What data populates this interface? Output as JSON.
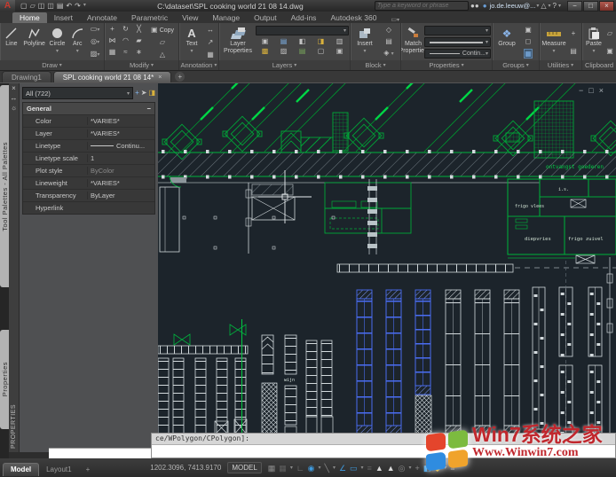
{
  "title_bar": {
    "document_path": "C:\\dataset\\SPL cooking world 21 08 14.dwg",
    "search_placeholder": "Type a keyword or phrase",
    "user_name": "jo.de.leeuw@..."
  },
  "ribbon": {
    "tabs": [
      "Home",
      "Insert",
      "Annotate",
      "Parametric",
      "View",
      "Manage",
      "Output",
      "Add-ins",
      "Autodesk 360"
    ],
    "panels": {
      "draw": {
        "label": "Draw",
        "line": "Line",
        "polyline": "Polyline",
        "circle": "Circle",
        "arc": "Arc"
      },
      "modify": {
        "label": "Modify",
        "copy": "Copy"
      },
      "annotation": {
        "label": "Annotation",
        "text": "Text"
      },
      "layers": {
        "label": "Layers",
        "layer_properties": "Layer Properties"
      },
      "block": {
        "label": "Block",
        "insert": "Insert"
      },
      "properties": {
        "label": "Properties",
        "match_properties": "Match Properties",
        "linetype_value": "Contin..."
      },
      "groups": {
        "label": "Groups",
        "group": "Group"
      },
      "utilities": {
        "label": "Utilities",
        "measure": "Measure"
      },
      "clipboard": {
        "label": "Clipboard",
        "paste": "Paste"
      }
    }
  },
  "document_tabs": {
    "drawing1": "Drawing1",
    "active_tab": "SPL cooking world 21 08 14*",
    "new_tab": "+"
  },
  "side_tabs": {
    "tool_palettes": "Tool Palettes - All Palettes",
    "properties": "Properties"
  },
  "properties_palette": {
    "title": "PROPERTIES",
    "selection": "All (722)",
    "section": "General",
    "rows": [
      {
        "label": "Color",
        "value": "*VARIES*"
      },
      {
        "label": "Layer",
        "value": "*VARIES*"
      },
      {
        "label": "Linetype",
        "value": "Continu..."
      },
      {
        "label": "Linetype scale",
        "value": "1"
      },
      {
        "label": "Plot style",
        "value": "ByColor"
      },
      {
        "label": "Lineweight",
        "value": "*VARIES*"
      },
      {
        "label": "Transparency",
        "value": "ByLayer"
      },
      {
        "label": "Hyperlink",
        "value": ""
      }
    ]
  },
  "drawing": {
    "labels": {
      "receiving": "ontvangst goederen",
      "is_room": "i.s.",
      "frigo_vlees": "frigo vlees",
      "diepvries": "diepvries",
      "frigo_zuivel": "frigo zuivel",
      "wijn": "wijn"
    },
    "colors": {
      "background": "#1c242b",
      "green": "#00a838",
      "white": "#d3dadd",
      "selection_blue": "#4a6df2"
    }
  },
  "command_line": {
    "prompt": "ce/WPolygon/CPolygon]:"
  },
  "status_bar": {
    "coordinates": "1202.3096, 7413.9170",
    "model_space": "MODEL",
    "model_tab": "Model",
    "layout_tab": "Layout1",
    "new_layout": "+"
  },
  "watermark": {
    "line1": "Win7系统之家",
    "line2": "Www.Winwin7.com"
  },
  "icons": {
    "caret": "▾",
    "close": "×",
    "minimize": "−",
    "maximize": "□",
    "help": "?",
    "section_collapse": "−",
    "grid": "▦",
    "snap": "▦",
    "ortho": "∟",
    "polar": "◉",
    "isodraft": "╲",
    "osnap": "∠",
    "dynamic_input": "▭",
    "lineweight": "≡",
    "annotation_1": "▲",
    "annotation_2": "▲",
    "annotation_scale": "◎",
    "plus": "+",
    "hardware": "◧",
    "isolate": "◆",
    "menu": "≡",
    "palette_autohide": "↔",
    "palette_settings": "☼",
    "new_file": "▢",
    "open_file": "▱",
    "save_file": "◫",
    "plot": "▤",
    "undo": "↶",
    "redo": "↷",
    "a360": "△",
    "pickadd": "+",
    "quick_select": "◨",
    "select_objects": "➤"
  }
}
